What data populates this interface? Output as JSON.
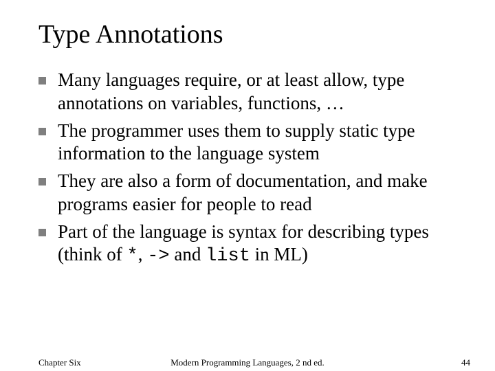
{
  "title": "Type Annotations",
  "bullets": [
    {
      "pre": "Many languages require, or at least allow, type annotations on variables, functions, …"
    },
    {
      "pre": "The programmer uses them to supply static type information to the language system"
    },
    {
      "pre": "They are also a form of documentation, and make programs easier for people to read"
    },
    {
      "pre": "Part of the language is syntax for describing types (think of ",
      "c1": "*",
      "m1": ", ",
      "c2": "->",
      "m2": " and ",
      "c3": "list",
      "post": " in ML)"
    }
  ],
  "footer": {
    "left": "Chapter Six",
    "center": "Modern Programming Languages, 2 nd ed.",
    "right": "44"
  }
}
